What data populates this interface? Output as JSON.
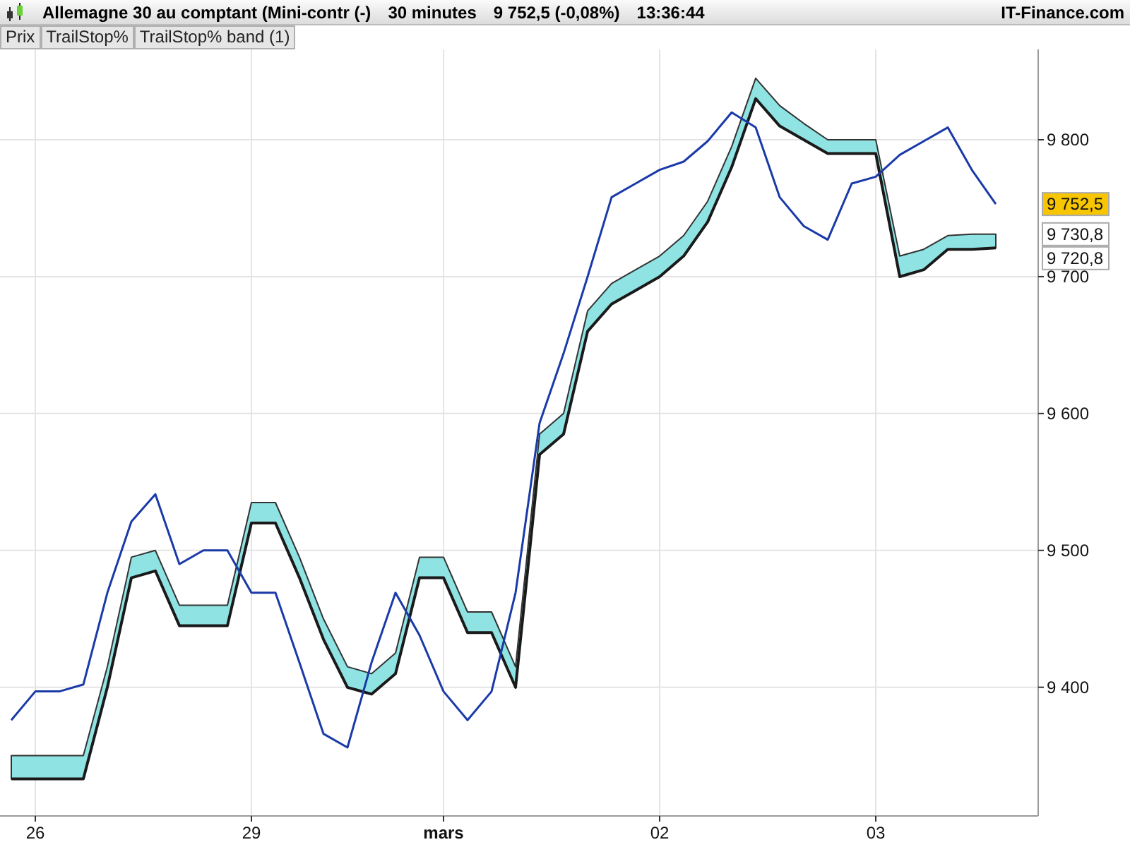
{
  "header": {
    "title": "Allemagne 30 au comptant (Mini-contr (-)",
    "period": "30 minutes",
    "quote": "9 752,5 (-0,08%)",
    "time": "13:36:44",
    "site": "IT-Finance.com"
  },
  "price_tags": [
    {
      "text": "9 752,5",
      "color": "#f7c600"
    },
    {
      "text": "9 730,8",
      "color": "#ffffff"
    },
    {
      "text": "9 720,8",
      "color": "#ffffff"
    }
  ],
  "chart": {
    "chart_data": {
      "type": "line",
      "categories": [
        null,
        "26",
        null,
        null,
        null,
        null,
        null,
        null,
        null,
        null,
        "29",
        null,
        null,
        null,
        null,
        null,
        null,
        null,
        "mars",
        null,
        null,
        null,
        null,
        null,
        null,
        null,
        null,
        "02",
        null,
        null,
        null,
        null,
        null,
        null,
        null,
        null,
        "03",
        null,
        null,
        null,
        null,
        null
      ],
      "series": [
        {
          "name": "Prix",
          "color": "#1a3aa8",
          "values": [
            9376,
            9397,
            9397,
            9402,
            9469,
            9521,
            9541,
            9490,
            9500,
            9500,
            9469,
            9469,
            9418,
            9366,
            9356,
            9418,
            9469,
            9438,
            9397,
            9376,
            9397,
            9469,
            9593,
            9644,
            9700,
            9758,
            9768,
            9778,
            9784,
            9799,
            9820,
            9809,
            9758,
            9737,
            9727,
            9768,
            9773,
            9789,
            9799,
            9809,
            9778,
            9753
          ]
        },
        {
          "name": "TrailStop%",
          "color": "#1a1a1a",
          "values": [
            9333,
            9333,
            9333,
            9333,
            9400,
            9480,
            9485,
            9445,
            9445,
            9445,
            9520,
            9520,
            9480,
            9435,
            9400,
            9395,
            9410,
            9480,
            9480,
            9440,
            9440,
            9400,
            9570,
            9585,
            9660,
            9680,
            9690,
            9700,
            9715,
            9740,
            9780,
            9830,
            9810,
            9800,
            9790,
            9790,
            9790,
            9700,
            9705,
            9720,
            9720,
            9721
          ]
        },
        {
          "name": "TrailStop% band (1)",
          "type": "area",
          "color": "#8fe3e3",
          "values": [
            9350,
            9350,
            9350,
            9350,
            9415,
            9495,
            9500,
            9460,
            9460,
            9460,
            9535,
            9535,
            9495,
            9450,
            9415,
            9410,
            9425,
            9495,
            9495,
            9455,
            9455,
            9415,
            9585,
            9600,
            9675,
            9695,
            9705,
            9715,
            9730,
            9755,
            9795,
            9845,
            9825,
            9812,
            9800,
            9800,
            9800,
            9715,
            9720,
            9730,
            9731,
            9731
          ]
        }
      ],
      "grid": true,
      "ylim": [
        9306,
        9866
      ],
      "yticks": [
        {
          "value": 9400,
          "label": "9 400"
        },
        {
          "value": 9500,
          "label": "9 500"
        },
        {
          "value": 9600,
          "label": "9 600"
        },
        {
          "value": 9700,
          "label": "9 700"
        },
        {
          "value": 9800,
          "label": "9 800"
        }
      ]
    }
  }
}
